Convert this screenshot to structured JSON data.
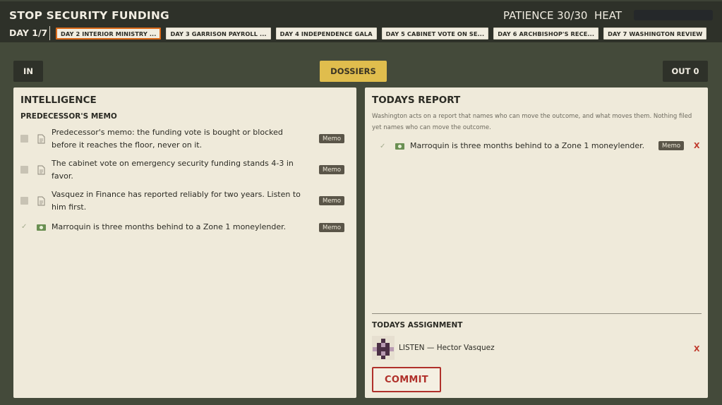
{
  "header": {
    "title": "STOP SECURITY FUNDING",
    "patience": "PATIENCE 30/30",
    "heat_label": "HEAT",
    "heat_level": 0,
    "day": "DAY 1/7",
    "tabs": [
      {
        "label": "DAY 2  INTERIOR MINISTRY ...",
        "active": true
      },
      {
        "label": "DAY 3  GARRISON PAYROLL ...",
        "active": false
      },
      {
        "label": "DAY 4  INDEPENDENCE GALA",
        "active": false
      },
      {
        "label": "DAY 5  CABINET VOTE ON SE...",
        "active": false
      },
      {
        "label": "DAY 6  ARCHBISHOP'S RECE...",
        "active": false
      },
      {
        "label": "DAY 7  WASHINGTON REVIEW",
        "active": false
      }
    ]
  },
  "controls": {
    "in_label": "IN",
    "dossiers_label": "DOSSIERS",
    "out_label": "OUT 0"
  },
  "intelligence": {
    "title": "INTELLIGENCE",
    "section": "PREDECESSOR'S MEMO",
    "items": [
      {
        "text": "Predecessor's memo: the funding vote is bought or blocked before it reaches the floor, never on it.",
        "tag": "Memo",
        "icon": "document-icon",
        "selected": false
      },
      {
        "text": "The cabinet vote on emergency security funding stands 4-3 in favor.",
        "tag": "Memo",
        "icon": "document-icon",
        "selected": false
      },
      {
        "text": "Vasquez in Finance has reported reliably for two years. Listen to him first.",
        "tag": "Memo",
        "icon": "document-icon",
        "selected": false
      },
      {
        "text": "Marroquin is three months behind to a Zone 1 moneylender.",
        "tag": "Memo",
        "icon": "money-icon",
        "selected": true
      }
    ]
  },
  "report": {
    "title": "TODAYS REPORT",
    "description": "Washington acts on a report that names who can move the outcome, and what moves them. Nothing filed yet names who can move the outcome.",
    "items": [
      {
        "text": "Marroquin is three months behind to a Zone 1 moneylender.",
        "tag": "Memo",
        "remove": "X"
      }
    ]
  },
  "assignment": {
    "title": "TODAYS ASSIGNMENT",
    "text": "LISTEN — Hector Vasquez",
    "remove": "X",
    "commit_label": "COMMIT"
  },
  "colors": {
    "background": "#444a3a",
    "header": "#2e3129",
    "panel": "#efeada",
    "accent_gold": "#e0bd4d",
    "active_tab_border": "#d96a1a",
    "danger": "#b0302a"
  }
}
